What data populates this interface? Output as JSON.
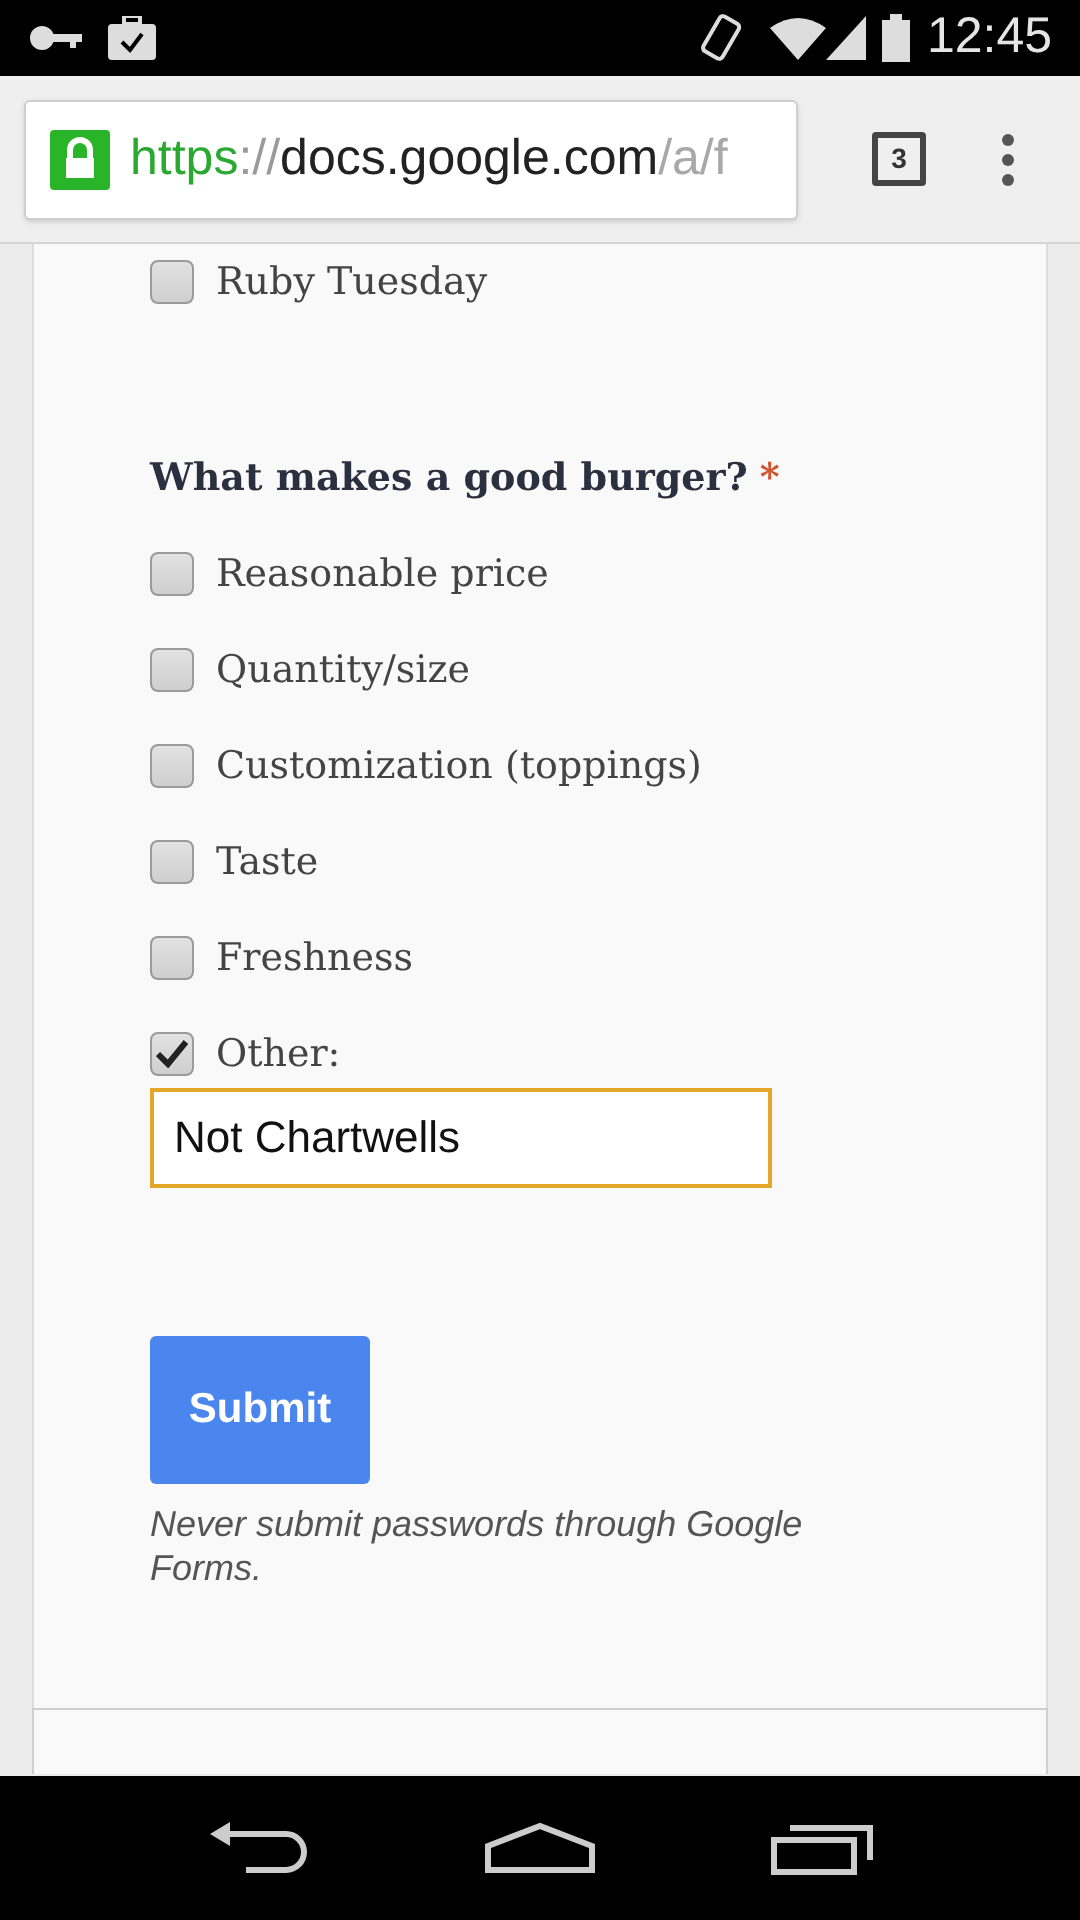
{
  "status_bar": {
    "time": "12:45"
  },
  "address_bar": {
    "url_parts": [
      {
        "kind": "scheme",
        "text": "https"
      },
      {
        "kind": "separator",
        "text": "://"
      },
      {
        "kind": "host",
        "text": "docs.google.com"
      },
      {
        "kind": "path",
        "text": "/a/f"
      }
    ],
    "tab_count": "3"
  },
  "previous_options": [
    {
      "label": "Ruby Tuesday",
      "checked": false
    }
  ],
  "question": {
    "title": "What makes a good burger?",
    "required_mark": "*",
    "options": [
      {
        "label": "Reasonable price",
        "checked": false
      },
      {
        "label": "Quantity/size",
        "checked": false
      },
      {
        "label": "Customization (toppings)",
        "checked": false
      },
      {
        "label": "Taste",
        "checked": false
      },
      {
        "label": "Freshness",
        "checked": false
      },
      {
        "label": "Other:",
        "checked": true
      }
    ],
    "other_value": "Not Chartwells"
  },
  "submit_button": "Submit",
  "note": "Never submit passwords through Google Forms."
}
